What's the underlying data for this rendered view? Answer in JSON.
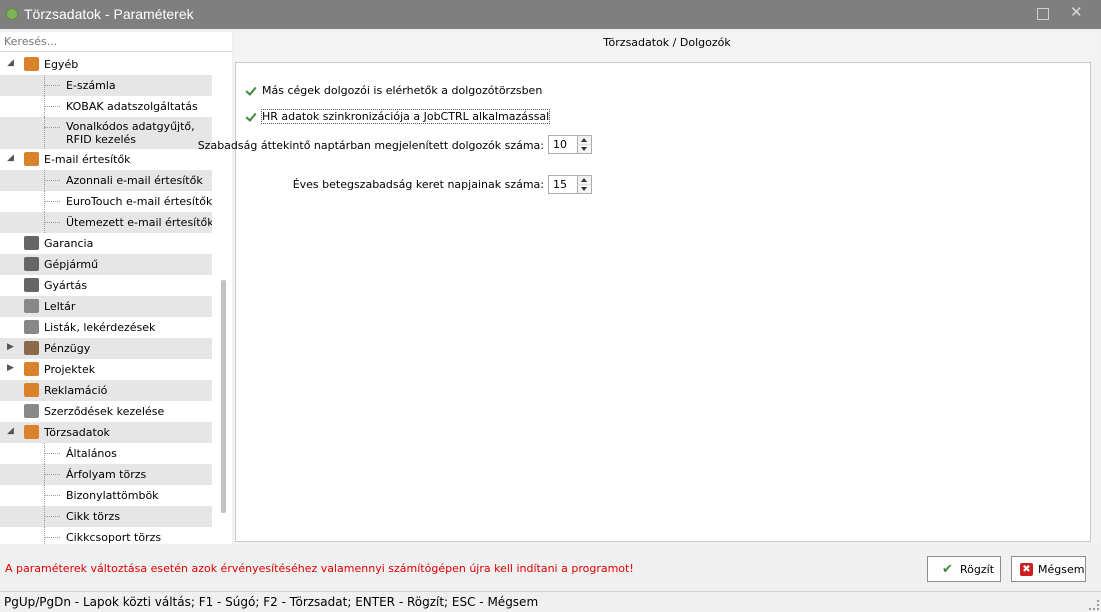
{
  "window": {
    "title": "Törzsadatok - Paraméterek",
    "icon": "app-icon"
  },
  "search": {
    "placeholder": "Keresés..."
  },
  "tree": [
    {
      "label": "Egyéb",
      "level": 0,
      "expander": "expanded",
      "icon": "settings-icon",
      "icon_color": "#d9822b",
      "alt": false
    },
    {
      "label": "E-számla",
      "level": 1,
      "alt": true
    },
    {
      "label": "KOBAK adatszolgáltatás",
      "level": 1,
      "alt": false
    },
    {
      "label": "Vonalkódos adatgyűjtő, RFID kezelés",
      "level": 1,
      "alt": true,
      "tall": true
    },
    {
      "label": "E-mail értesítők",
      "level": 0,
      "expander": "expanded",
      "icon": "email-icon",
      "icon_color": "#d9822b",
      "alt": false
    },
    {
      "label": "Azonnali e-mail értesítők",
      "level": 1,
      "alt": true
    },
    {
      "label": "EuroTouch e-mail értesítők",
      "level": 1,
      "alt": false
    },
    {
      "label": "Ütemezett e-mail értesítők",
      "level": 1,
      "alt": true
    },
    {
      "label": "Garancia",
      "level": 0,
      "icon": "clock-icon",
      "icon_color": "#666666",
      "alt": false
    },
    {
      "label": "Gépjármű",
      "level": 0,
      "icon": "car-icon",
      "icon_color": "#666666",
      "alt": true
    },
    {
      "label": "Gyártás",
      "level": 0,
      "icon": "factory-icon",
      "icon_color": "#666666",
      "alt": false
    },
    {
      "label": "Leltár",
      "level": 0,
      "icon": "inventory-icon",
      "icon_color": "#888888",
      "alt": true
    },
    {
      "label": "Listák, lekérdezések",
      "level": 0,
      "icon": "list-icon",
      "icon_color": "#888888",
      "alt": false
    },
    {
      "label": "Pénzügy",
      "level": 0,
      "expander": "collapsed",
      "icon": "finance-icon",
      "icon_color": "#8a6a4a",
      "alt": true
    },
    {
      "label": "Projektek",
      "level": 0,
      "expander": "collapsed",
      "icon": "projects-icon",
      "icon_color": "#d9822b",
      "alt": false
    },
    {
      "label": "Reklamáció",
      "level": 0,
      "icon": "complaint-icon",
      "icon_color": "#d9822b",
      "alt": true
    },
    {
      "label": "Szerződések kezelése",
      "level": 0,
      "icon": "contract-icon",
      "icon_color": "#888888",
      "alt": false
    },
    {
      "label": "Törzsadatok",
      "level": 0,
      "expander": "expanded",
      "icon": "master-data-icon",
      "icon_color": "#d9822b",
      "alt": true
    },
    {
      "label": "Általános",
      "level": 1,
      "alt": false
    },
    {
      "label": "Árfolyam törzs",
      "level": 1,
      "alt": true
    },
    {
      "label": "Bizonylattömbök",
      "level": 1,
      "alt": false
    },
    {
      "label": "Cikk törzs",
      "level": 1,
      "alt": true
    },
    {
      "label": "Cikkcsoport törzs",
      "level": 1,
      "alt": false
    }
  ],
  "header": {
    "title": "Törzsadatok / Dolgozók"
  },
  "settings": {
    "checkbox1": {
      "label": "Más cégek dolgozói is elérhetők a dolgozótörzsben",
      "checked": true
    },
    "checkbox2": {
      "label": "HR adatok szinkronizációja a JobCTRL alkalmazással",
      "checked": true
    },
    "field1": {
      "label": "Szabadság áttekintő naptárban megjelenített dolgozók száma:",
      "value": "10"
    },
    "field2": {
      "label": "Éves betegszabadság keret napjainak száma:",
      "value": "15"
    }
  },
  "footer": {
    "warning": "A paraméterek változtása esetén azok érvényesítéséhez valamennyi számítógépen újra kell indítani a programot!",
    "warning_color": "#e00000",
    "ok_label": "Rögzít",
    "cancel_label": "Mégsem"
  },
  "statusbar": {
    "text": "PgUp/PgDn - Lapok közti váltás; F1 - Súgó; F2 - Törzsadat; ENTER - Rögzít; ESC - Mégsem"
  }
}
